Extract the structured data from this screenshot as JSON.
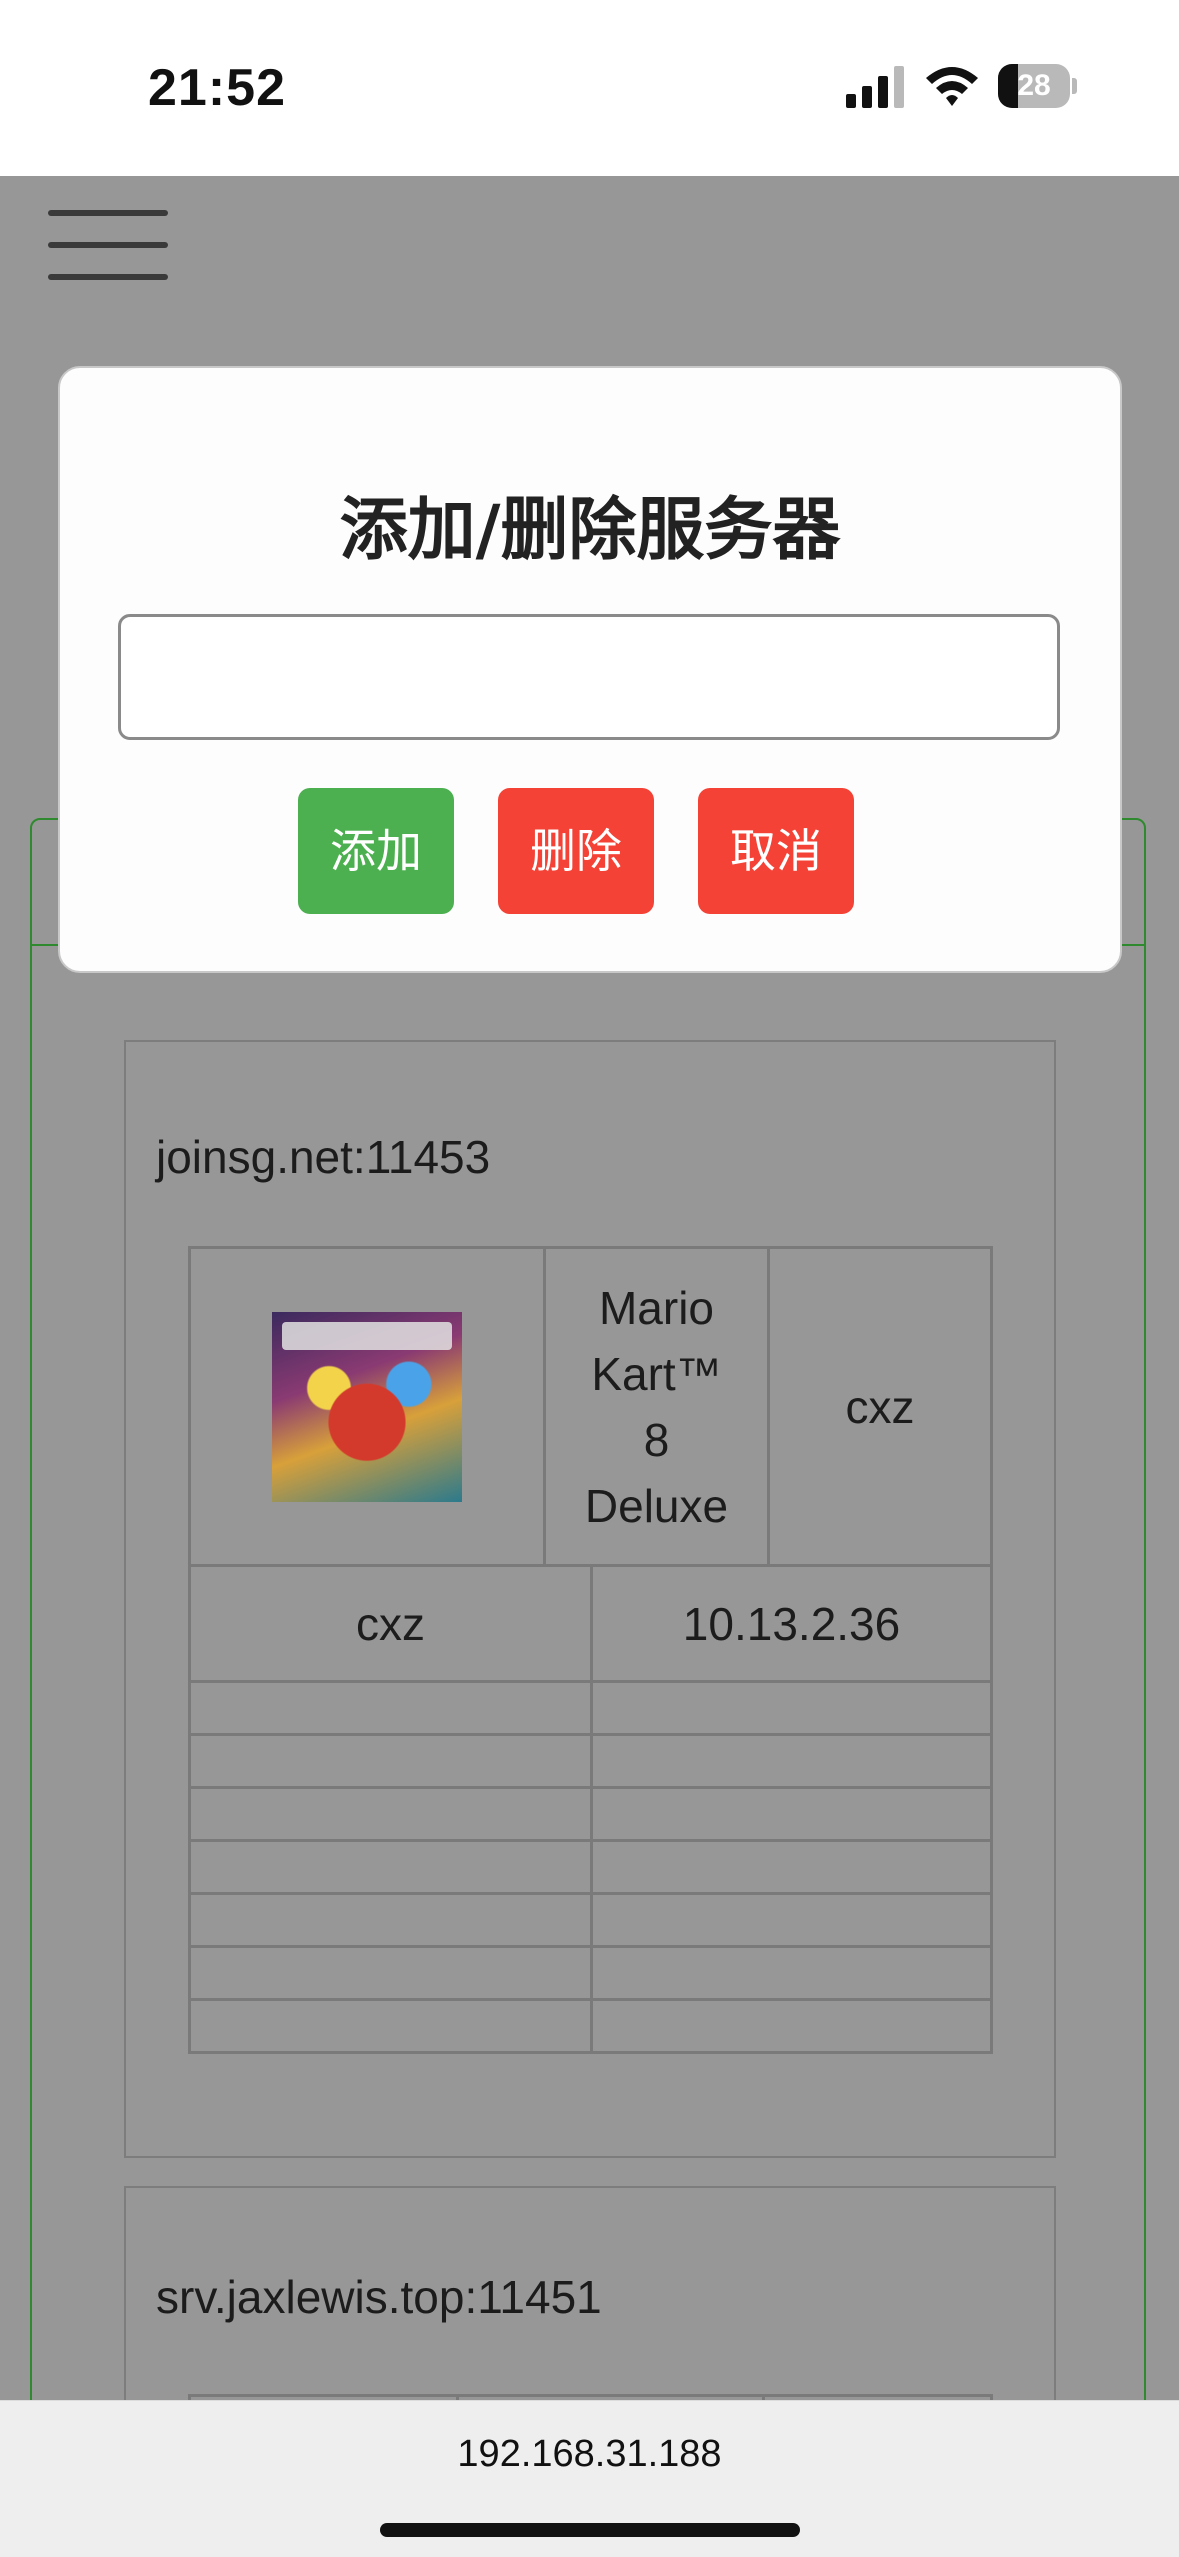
{
  "status_bar": {
    "time": "21:52",
    "battery_percent": "28",
    "battery_level": 0.28,
    "icons": [
      "signal-icon",
      "wifi-icon",
      "battery-icon"
    ]
  },
  "page": {
    "menu_icon": "hamburger-menu-icon",
    "servers": [
      {
        "host": "joinsg.net:11453",
        "game_title": "Mario Kart™ 8 Deluxe",
        "game_title_lines": [
          "Mario",
          "Kart™",
          "8",
          "Deluxe"
        ],
        "room": "cxz",
        "players": [
          {
            "name": "cxz",
            "ip": "10.13.2.36"
          }
        ]
      },
      {
        "host": "srv.jaxlewis.top:11451"
      }
    ]
  },
  "modal": {
    "title": "添加/删除服务器",
    "input_value": "",
    "buttons": {
      "add": "添加",
      "delete": "删除",
      "cancel": "取消"
    },
    "colors": {
      "add": "#4caf50",
      "delete": "#f44336",
      "cancel": "#f44336"
    }
  },
  "browser": {
    "url": "192.168.31.188"
  }
}
